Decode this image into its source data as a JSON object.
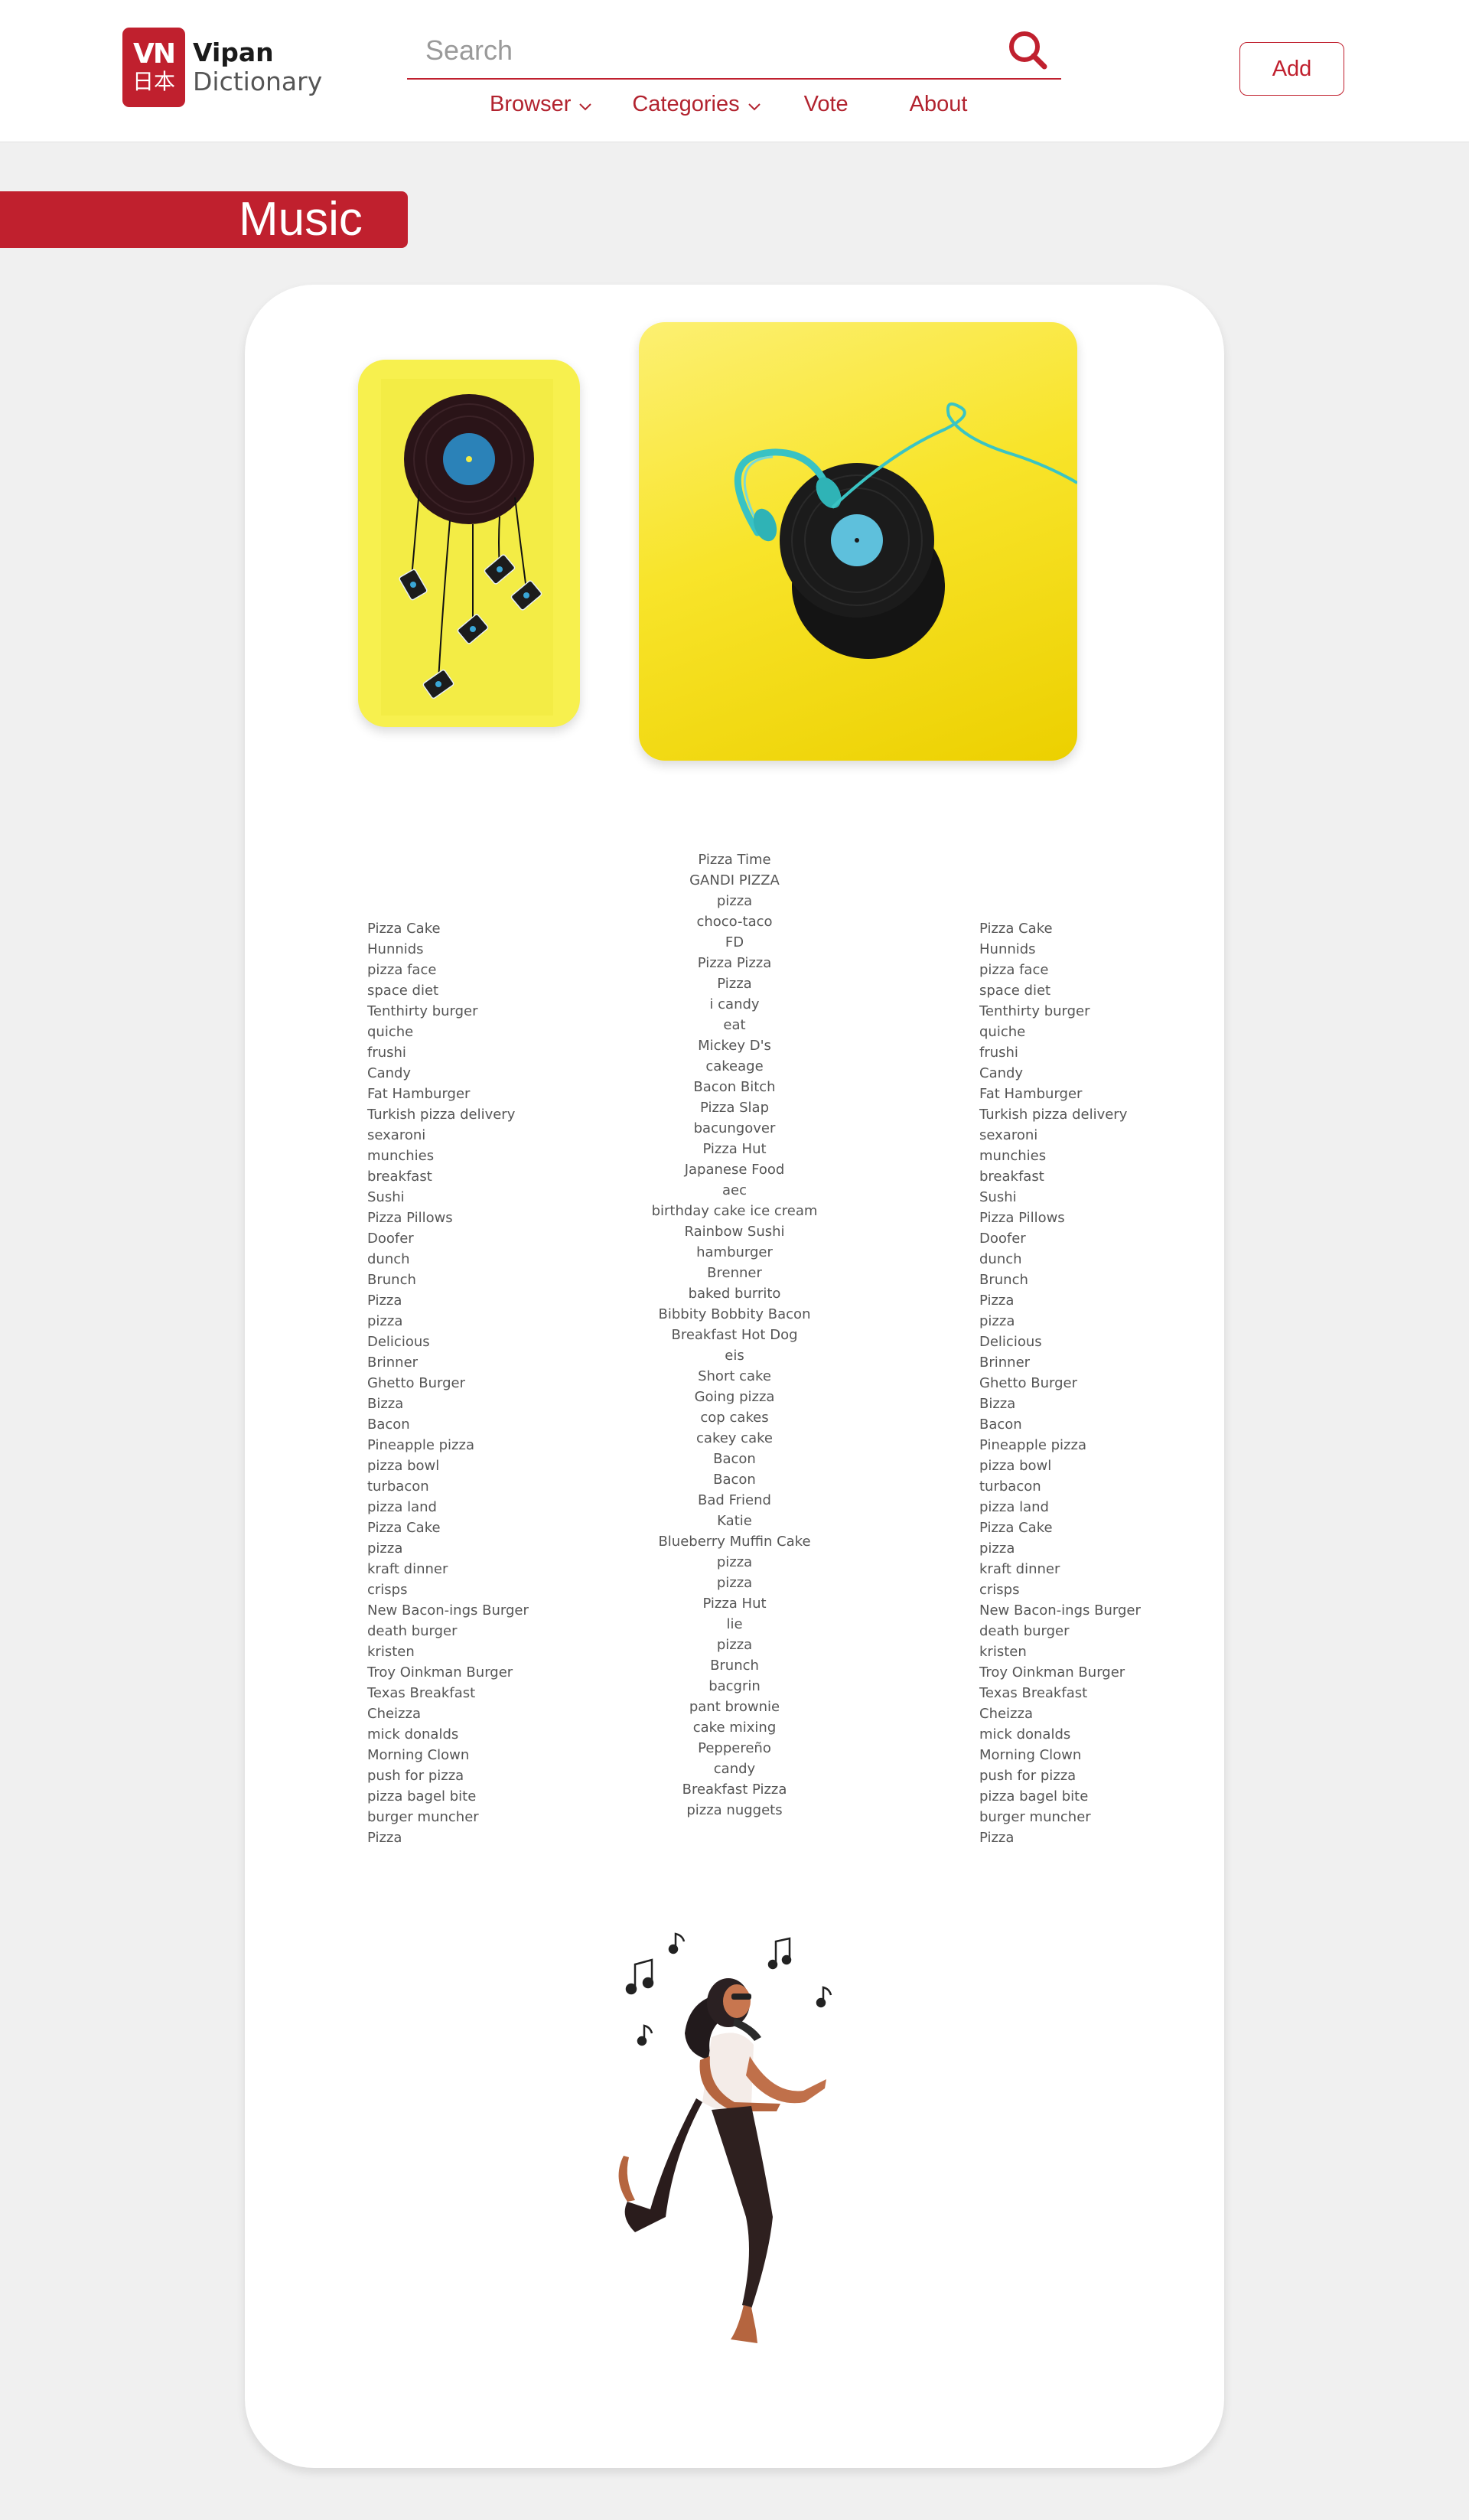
{
  "header": {
    "logo": {
      "mark_top": "VN",
      "mark_bottom": "日本",
      "name": "Vipan",
      "subtitle": "Dictionary"
    },
    "search": {
      "placeholder": "Search",
      "value": ""
    },
    "nav": [
      {
        "label": "Browser",
        "has_dropdown": true
      },
      {
        "label": "Categories",
        "has_dropdown": true
      },
      {
        "label": "Vote",
        "has_dropdown": false
      },
      {
        "label": "About",
        "has_dropdown": false
      }
    ],
    "add_label": "Add"
  },
  "banner": {
    "title": "Music"
  },
  "images": {
    "left_photo": "vinyl record with hanging cassette tapes on yellow background",
    "right_photo": "vinyl record with turquoise headphones on yellow background",
    "bottom_illustration": "woman dancing with music notes"
  },
  "icons": {
    "search": "search-icon",
    "dropdown": "chevron-down-icon"
  },
  "colors": {
    "brand": "#c0202e",
    "nav_text": "#b2232f",
    "page_bg": "#f0f0f0",
    "card_bg": "#ffffff",
    "word_text": "#555555"
  },
  "word_columns": {
    "left": [
      "Pizza Cake",
      "Hunnids",
      "pizza face",
      "space diet",
      "Tenthirty burger",
      "quiche",
      "frushi",
      "Candy",
      "Fat Hamburger",
      "Turkish pizza delivery",
      "sexaroni",
      "munchies",
      "breakfast",
      "Sushi",
      "Pizza Pillows",
      "Doofer",
      "dunch",
      "Brunch",
      "Pizza",
      "pizza",
      "Delicious",
      "Brinner",
      "Ghetto Burger",
      "Bizza",
      "Bacon",
      "Pineapple pizza",
      "pizza bowl",
      "turbacon",
      "pizza land",
      "Pizza Cake",
      "pizza",
      "kraft dinner",
      "crisps",
      "New Bacon-ings Burger",
      "death burger",
      "kristen",
      "Troy Oinkman Burger",
      "Texas Breakfast",
      "Cheizza",
      "mick donalds",
      "Morning Clown",
      "push for pizza",
      "pizza bagel bite",
      "burger muncher",
      "Pizza"
    ],
    "middle": [
      "Pizza Time",
      "GANDI PIZZA",
      "pizza",
      "choco-taco",
      "FD",
      "Pizza Pizza",
      "Pizza",
      "i candy",
      "eat",
      "Mickey D's",
      "cakeage",
      "Bacon Bitch",
      "Pizza Slap",
      "bacungover",
      "Pizza Hut",
      "Japanese Food",
      "aec",
      "birthday cake ice cream",
      "Rainbow Sushi",
      "hamburger",
      "Brenner",
      "baked burrito",
      "Bibbity Bobbity Bacon",
      "Breakfast Hot Dog",
      "eis",
      "Short cake",
      "Going pizza",
      "cop cakes",
      "cakey cake",
      "Bacon",
      "Bacon",
      "Bad Friend",
      "Katie",
      "Blueberry Muffin Cake",
      "pizza",
      "pizza",
      "Pizza Hut",
      "lie",
      "pizza",
      "Brunch",
      "bacgrin",
      "pant brownie",
      "cake mixing",
      "Peppereño",
      "candy",
      "Breakfast Pizza",
      "pizza nuggets"
    ],
    "right": [
      "Pizza Cake",
      "Hunnids",
      "pizza face",
      "space diet",
      "Tenthirty burger",
      "quiche",
      "frushi",
      "Candy",
      "Fat Hamburger",
      "Turkish pizza delivery",
      "sexaroni",
      "munchies",
      "breakfast",
      "Sushi",
      "Pizza Pillows",
      "Doofer",
      "dunch",
      "Brunch",
      "Pizza",
      "pizza",
      "Delicious",
      "Brinner",
      "Ghetto Burger",
      "Bizza",
      "Bacon",
      "Pineapple pizza",
      "pizza bowl",
      "turbacon",
      "pizza land",
      "Pizza Cake",
      "pizza",
      "kraft dinner",
      "crisps",
      "New Bacon-ings Burger",
      "death burger",
      "kristen",
      "Troy Oinkman Burger",
      "Texas Breakfast",
      "Cheizza",
      "mick donalds",
      "Morning Clown",
      "push for pizza",
      "pizza bagel bite",
      "burger muncher",
      "Pizza"
    ]
  }
}
